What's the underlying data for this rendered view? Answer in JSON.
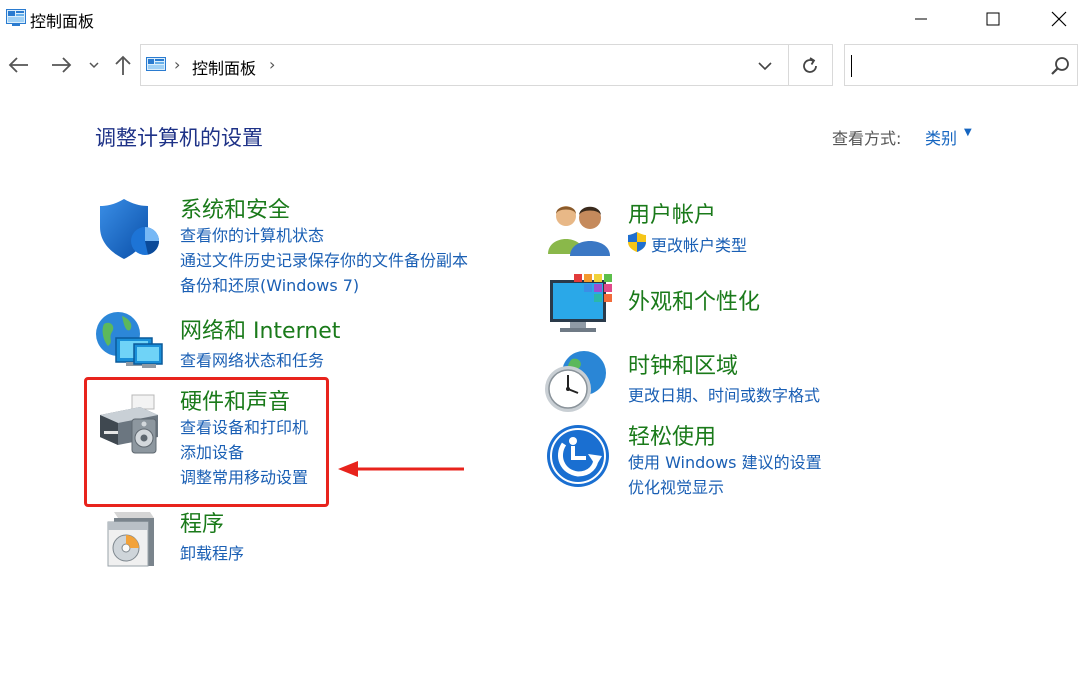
{
  "window": {
    "title": "控制面板"
  },
  "address": {
    "crumb": "控制面板",
    "separator": "›"
  },
  "search": {
    "placeholder": "",
    "value": ""
  },
  "content": {
    "heading": "调整计算机的设置",
    "view_by_label": "查看方式:",
    "view_by_value": "类别",
    "categories": [
      {
        "title": "系统和安全",
        "links": [
          "查看你的计算机状态",
          "通过文件历史记录保存你的文件备份副本",
          "备份和还原(Windows 7)"
        ],
        "icon": "security-shield-icon"
      },
      {
        "title": "网络和 Internet",
        "links": [
          "查看网络状态和任务"
        ],
        "icon": "network-globe-icon"
      },
      {
        "title": "硬件和声音",
        "links": [
          "查看设备和打印机",
          "添加设备",
          "调整常用移动设置"
        ],
        "icon": "printer-speaker-icon"
      },
      {
        "title": "程序",
        "links": [
          "卸载程序"
        ],
        "icon": "programs-disc-icon"
      },
      {
        "title": "用户帐户",
        "links": [
          "更改帐户类型"
        ],
        "icon": "users-icon"
      },
      {
        "title": "外观和个性化",
        "links": [],
        "icon": "display-palette-icon"
      },
      {
        "title": "时钟和区域",
        "links": [
          "更改日期、时间或数字格式"
        ],
        "icon": "clock-globe-icon"
      },
      {
        "title": "轻松使用",
        "links": [
          "使用 Windows 建议的设置",
          "优化视觉显示"
        ],
        "icon": "ease-of-access-icon"
      }
    ]
  },
  "colors": {
    "category_title": "#1a7a1a",
    "link": "#1a5fb4",
    "heading": "#1e3287",
    "annotation": "#e8231c"
  }
}
